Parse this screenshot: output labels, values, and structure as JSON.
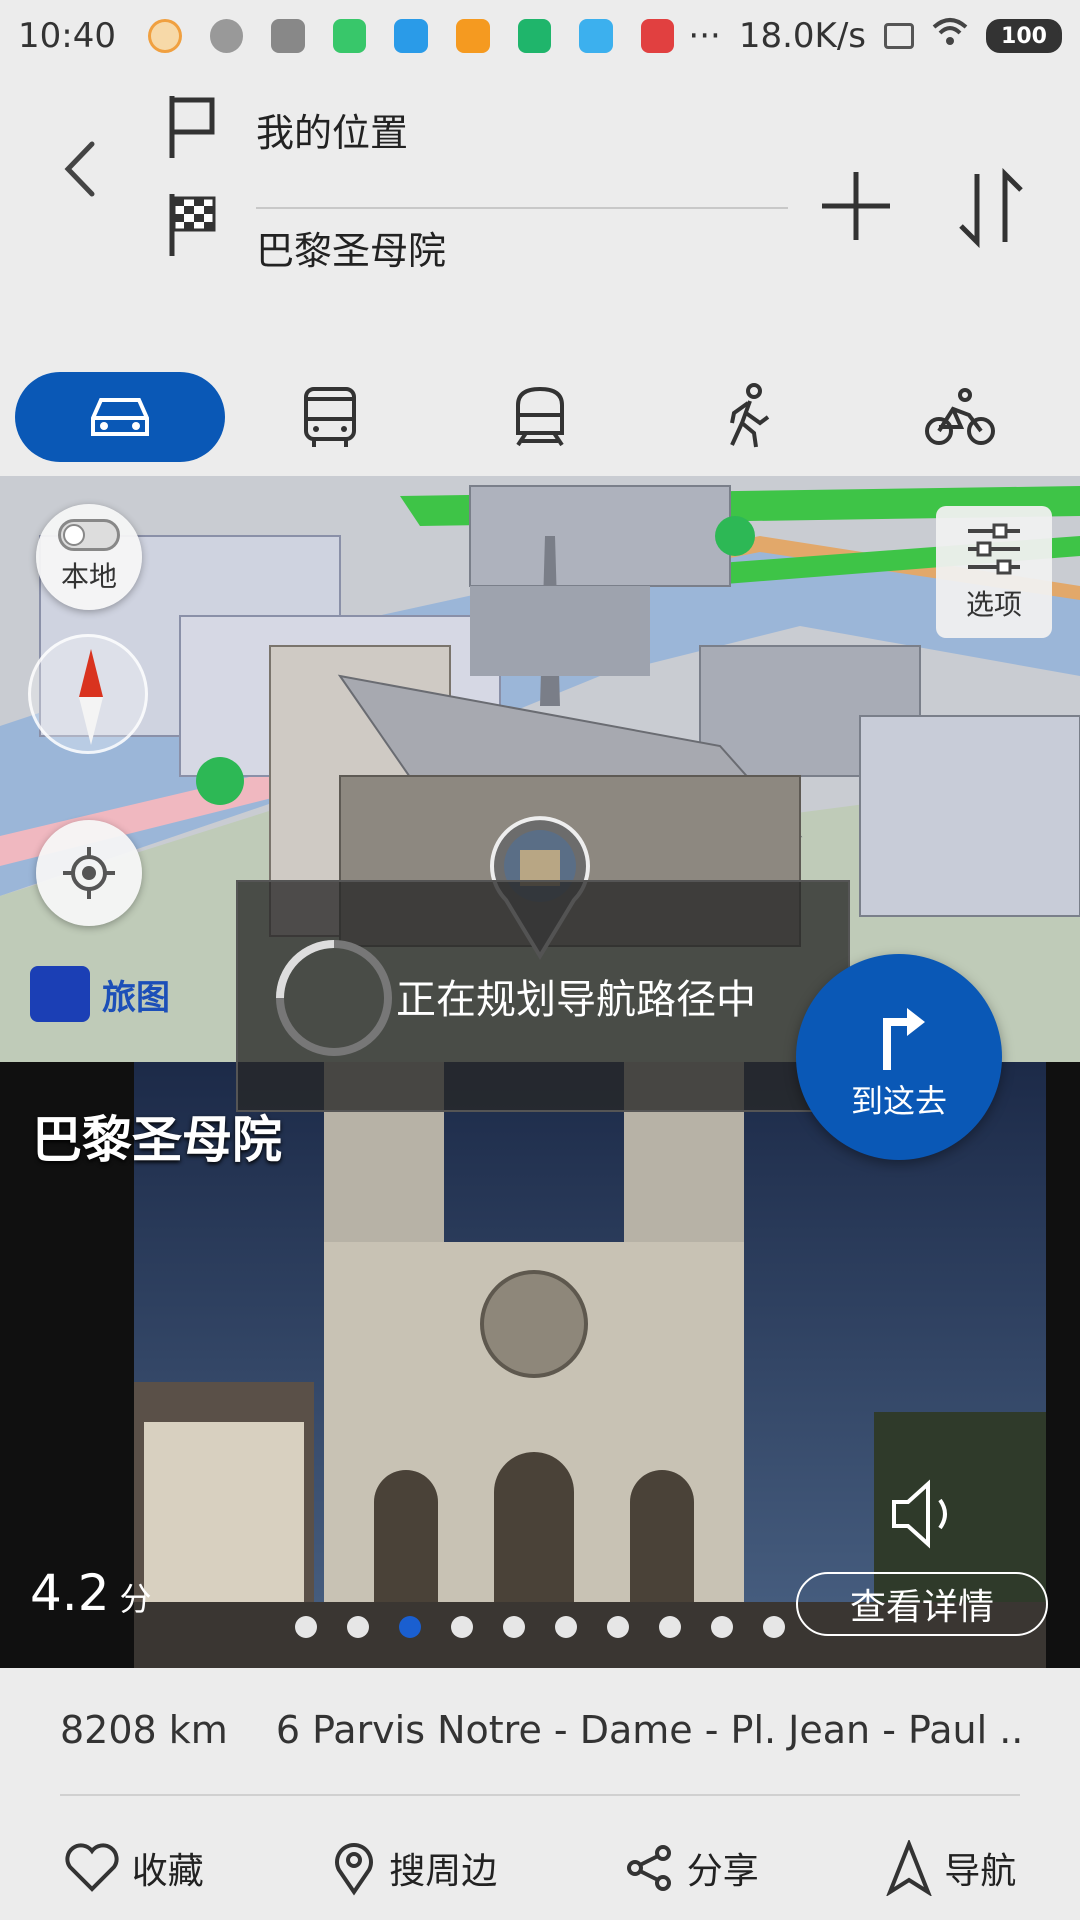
{
  "status_bar": {
    "time": "10:40",
    "network_speed": "18.0K/s",
    "more": "···",
    "battery": "100"
  },
  "route": {
    "start": "我的位置",
    "end": "巴黎圣母院"
  },
  "map": {
    "local_label": "本地",
    "options_label": "选项",
    "brand": "旅图"
  },
  "toast": {
    "message": "正在规划导航路径中"
  },
  "card": {
    "title": "巴黎圣母院",
    "rating": "4.2",
    "rating_unit": "分",
    "details_button": "查看详情",
    "go_here": "到这去"
  },
  "info": {
    "distance": "8208 km",
    "address": "6 Parvis Notre - Dame - Pl. Jean - Paul ..."
  },
  "actions": {
    "favorite": "收藏",
    "nearby": "搜周边",
    "share": "分享",
    "navigate": "导航"
  },
  "colors": {
    "accent": "#0a58b6",
    "background": "#ececec"
  }
}
